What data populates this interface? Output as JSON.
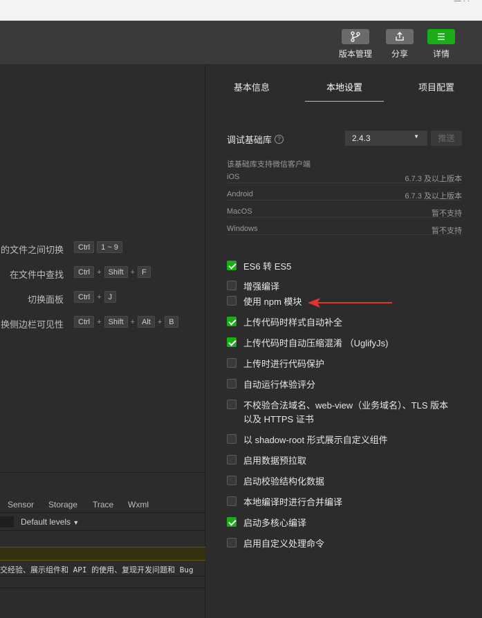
{
  "top_strip": {
    "fragment": "— · ·"
  },
  "toolbar": {
    "buttons": [
      {
        "label": "版本管理",
        "icon": "branch-icon"
      },
      {
        "label": "分享",
        "icon": "share-icon"
      },
      {
        "label": "详情",
        "icon": "menu-icon"
      }
    ]
  },
  "shortcuts": [
    {
      "label": "的文件之间切换",
      "keys": [
        "Ctrl",
        "1 ~ 9"
      ]
    },
    {
      "label": "在文件中查找",
      "keys": [
        "Ctrl",
        "+",
        "Shift",
        "+",
        "F"
      ]
    },
    {
      "label": "切换面板",
      "keys": [
        "Ctrl",
        "+",
        "J"
      ]
    },
    {
      "label": "换侧边栏可见性",
      "keys": [
        "Ctrl",
        "+",
        "Shift",
        "+",
        "Alt",
        "+",
        "B"
      ]
    }
  ],
  "devtools": {
    "tabs": [
      "Sensor",
      "Storage",
      "Trace",
      "Wxml"
    ],
    "levels_label": "Default levels",
    "console_text": "交经验、展示组件和 API 的使用、复现开发问题和 Bug"
  },
  "panel": {
    "tabs": [
      "基本信息",
      "本地设置",
      "项目配置"
    ],
    "active_tab": "本地设置",
    "lib_label": "调试基础库",
    "help_glyph": "?",
    "lib_version": "2.4.3",
    "push_label": "推送",
    "support_title": "该基础库支持微信客户端",
    "support_rows": [
      {
        "name": "iOS",
        "status": "6.7.3 及以上版本"
      },
      {
        "name": "Android",
        "status": "6.7.3 及以上版本"
      },
      {
        "name": "MacOS",
        "status": "暂不支持"
      },
      {
        "name": "Windows",
        "status": "暂不支持"
      }
    ],
    "options": [
      {
        "label": "ES6 转 ES5",
        "checked": true
      },
      {
        "label": "增强编译",
        "checked": false
      },
      {
        "label": "使用 npm 模块",
        "checked": false
      },
      {
        "label": "上传代码时样式自动补全",
        "checked": true
      },
      {
        "label": "上传代码时自动压缩混淆 （UglifyJs)",
        "checked": true
      },
      {
        "label": "上传时进行代码保护",
        "checked": false
      },
      {
        "label": "自动运行体验评分",
        "checked": false
      },
      {
        "label": "不校验合法域名、web-view（业务域名）、TLS 版本以及 HTTPS 证书",
        "checked": false
      },
      {
        "label": "以 shadow-root 形式展示自定义组件",
        "checked": false
      },
      {
        "label": "启用数据预拉取",
        "checked": false
      },
      {
        "label": "启动校验结构化数据",
        "checked": false
      },
      {
        "label": "本地编译时进行合并编译",
        "checked": false
      },
      {
        "label": "启动多核心编译",
        "checked": true
      },
      {
        "label": "启用自定义处理命令",
        "checked": false
      }
    ]
  },
  "colors": {
    "accent": "#1aad19",
    "annotation_arrow": "#e8322e"
  }
}
